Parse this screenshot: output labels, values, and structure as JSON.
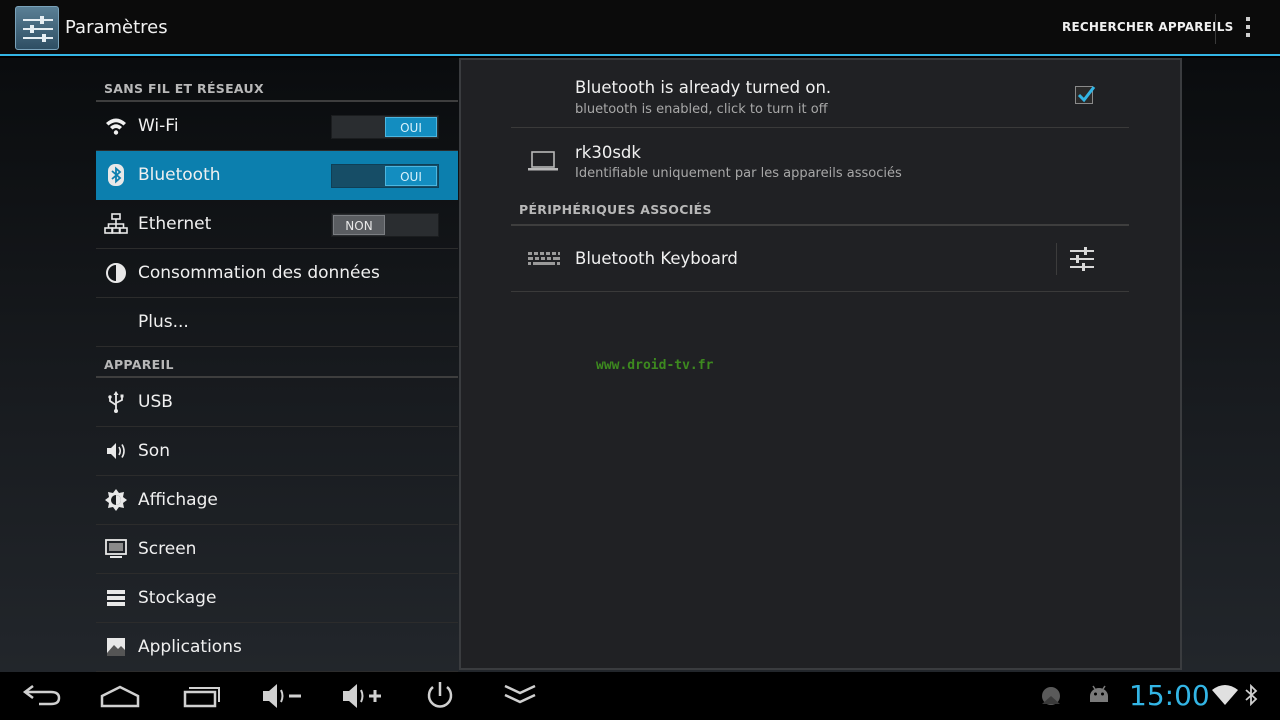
{
  "actionbar": {
    "title": "Paramètres",
    "search_label": "RECHERCHER APPAREILS",
    "app_icon": "settings-sliders-icon",
    "overflow_icon": "overflow-menu-icon"
  },
  "left": {
    "wireless_header": "SANS FIL ET RÉSEAUX",
    "device_header": "APPAREIL",
    "wifi": {
      "label": "Wi-Fi",
      "toggle": "OUI",
      "icon": "wifi-icon"
    },
    "bluetooth": {
      "label": "Bluetooth",
      "toggle": "OUI",
      "icon": "bluetooth-icon"
    },
    "ethernet": {
      "label": "Ethernet",
      "toggle": "NON",
      "icon": "ethernet-icon"
    },
    "data_usage": {
      "label": "Consommation des données",
      "icon": "data-usage-icon"
    },
    "more": {
      "label": "Plus..."
    },
    "usb": {
      "label": "USB",
      "icon": "usb-icon"
    },
    "sound": {
      "label": "Son",
      "icon": "sound-icon"
    },
    "display": {
      "label": "Affichage",
      "icon": "brightness-icon"
    },
    "screen": {
      "label": "Screen",
      "icon": "screen-icon"
    },
    "storage": {
      "label": "Stockage",
      "icon": "storage-icon"
    },
    "apps": {
      "label": "Applications",
      "icon": "applications-icon"
    }
  },
  "right": {
    "bt_status_title": "Bluetooth is already turned on.",
    "bt_status_sub": "bluetooth is enabled, click to turn it off",
    "bt_enabled": true,
    "device_name": "rk30sdk",
    "device_visibility": "Identifiable uniquement par les appareils associés",
    "paired_header": "PÉRIPHÉRIQUES ASSOCIÉS",
    "paired_device": "Bluetooth Keyboard",
    "watermark": "www.droid-tv.fr"
  },
  "sysbar": {
    "clock": "15:00",
    "buttons": [
      "back-icon",
      "home-icon",
      "recent-apps-icon",
      "volume-down-icon",
      "volume-up-icon",
      "power-icon",
      "collapse-icon"
    ]
  },
  "colors": {
    "accent": "#33b5e5",
    "selected": "#0c7fae",
    "watermark": "#3d8a1f"
  }
}
